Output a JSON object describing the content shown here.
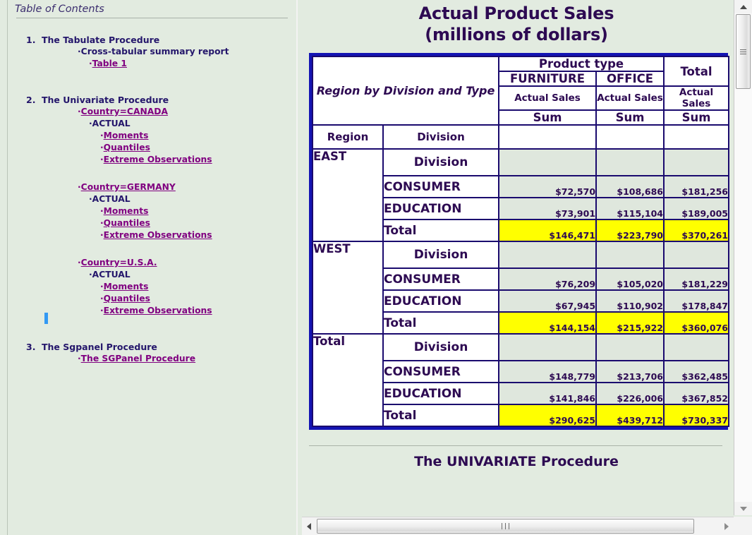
{
  "toc": {
    "title": "Table of Contents",
    "sections": [
      {
        "number": "1.",
        "heading": "The Tabulate Procedure",
        "entries": [
          {
            "label": "·Cross-tabular summary report",
            "link": false,
            "level": 1
          },
          {
            "label": "·Table 1",
            "link": true,
            "level": 2
          }
        ]
      },
      {
        "number": "2.",
        "heading": "The Univariate Procedure",
        "entries": [
          {
            "label": "·Country=CANADA",
            "link": true,
            "level": 1
          },
          {
            "label": "·ACTUAL",
            "link": false,
            "level": 2
          },
          {
            "label": "·Moments",
            "link": true,
            "level": 3
          },
          {
            "label": "·Quantiles",
            "link": true,
            "level": 3
          },
          {
            "label": "·Extreme Observations",
            "link": true,
            "level": 3
          },
          {
            "label": "·Country=GERMANY",
            "link": true,
            "level": 1,
            "gap_before": true
          },
          {
            "label": "·ACTUAL",
            "link": false,
            "level": 2
          },
          {
            "label": "·Moments",
            "link": true,
            "level": 3
          },
          {
            "label": "·Quantiles",
            "link": true,
            "level": 3
          },
          {
            "label": "·Extreme Observations",
            "link": true,
            "level": 3
          },
          {
            "label": "·Country=U.S.A.",
            "link": true,
            "level": 1,
            "gap_before": true
          },
          {
            "label": "·ACTUAL",
            "link": false,
            "level": 2
          },
          {
            "label": "·Moments",
            "link": true,
            "level": 3
          },
          {
            "label": "·Quantiles",
            "link": true,
            "level": 3
          },
          {
            "label": "·Extreme Observations",
            "link": true,
            "level": 3
          }
        ]
      },
      {
        "number": "3.",
        "heading": "The Sgpanel Procedure",
        "entries": [
          {
            "label": "·The SGPanel Procedure",
            "link": true,
            "level": 1
          }
        ]
      }
    ]
  },
  "report": {
    "title_line1": "Actual Product Sales",
    "title_line2": "(millions of dollars)",
    "next_section_title": "The UNIVARIATE Procedure",
    "table": {
      "stub_header": "Region by Division and Type",
      "spanner": "Product type",
      "total_spanner": "Total",
      "product_types": [
        "FURNITURE",
        "OFFICE"
      ],
      "measure_row": [
        "Actual Sales",
        "Actual Sales",
        "Actual Sales"
      ],
      "statistic_row": [
        "Sum",
        "Sum",
        "Sum"
      ],
      "row_headers": [
        "Region",
        "Division"
      ],
      "groups": [
        {
          "region": "EAST",
          "division_header": "Division",
          "rows": [
            {
              "label": "CONSUMER",
              "values": [
                "$72,570",
                "$108,686",
                "$181,256"
              ],
              "total": false
            },
            {
              "label": "EDUCATION",
              "values": [
                "$73,901",
                "$115,104",
                "$189,005"
              ],
              "total": false
            },
            {
              "label": "Total",
              "values": [
                "$146,471",
                "$223,790",
                "$370,261"
              ],
              "total": true
            }
          ]
        },
        {
          "region": "WEST",
          "division_header": "Division",
          "rows": [
            {
              "label": "CONSUMER",
              "values": [
                "$76,209",
                "$105,020",
                "$181,229"
              ],
              "total": false
            },
            {
              "label": "EDUCATION",
              "values": [
                "$67,945",
                "$110,902",
                "$178,847"
              ],
              "total": false
            },
            {
              "label": "Total",
              "values": [
                "$144,154",
                "$215,922",
                "$360,076"
              ],
              "total": true
            }
          ]
        },
        {
          "region": "Total",
          "division_header": "Division",
          "rows": [
            {
              "label": "CONSUMER",
              "values": [
                "$148,779",
                "$213,706",
                "$362,485"
              ],
              "total": false
            },
            {
              "label": "EDUCATION",
              "values": [
                "$141,846",
                "$226,006",
                "$367,852"
              ],
              "total": false
            },
            {
              "label": "Total",
              "values": [
                "$290,625",
                "$439,712",
                "$730,337"
              ],
              "total": true
            }
          ]
        }
      ]
    }
  },
  "colors": {
    "page_background": "#e2ebe0",
    "table_border": "#1414b4",
    "cell_border": "#1a0a6e",
    "text": "#2d0a52",
    "toc_heading": "#24166b",
    "toc_link": "#800080",
    "highlight": "#ffff00",
    "data_cell_background": "#dfe7dd",
    "caret": "#3399f3"
  },
  "scrollbars": {
    "vertical": {
      "up_icon": "triangle-up-icon",
      "down_icon": "triangle-down-icon",
      "thumb": "vertical-scroll-thumb"
    },
    "horizontal": {
      "left_icon": "triangle-left-icon",
      "right_icon": "triangle-right-icon",
      "thumb": "horizontal-scroll-thumb"
    }
  }
}
